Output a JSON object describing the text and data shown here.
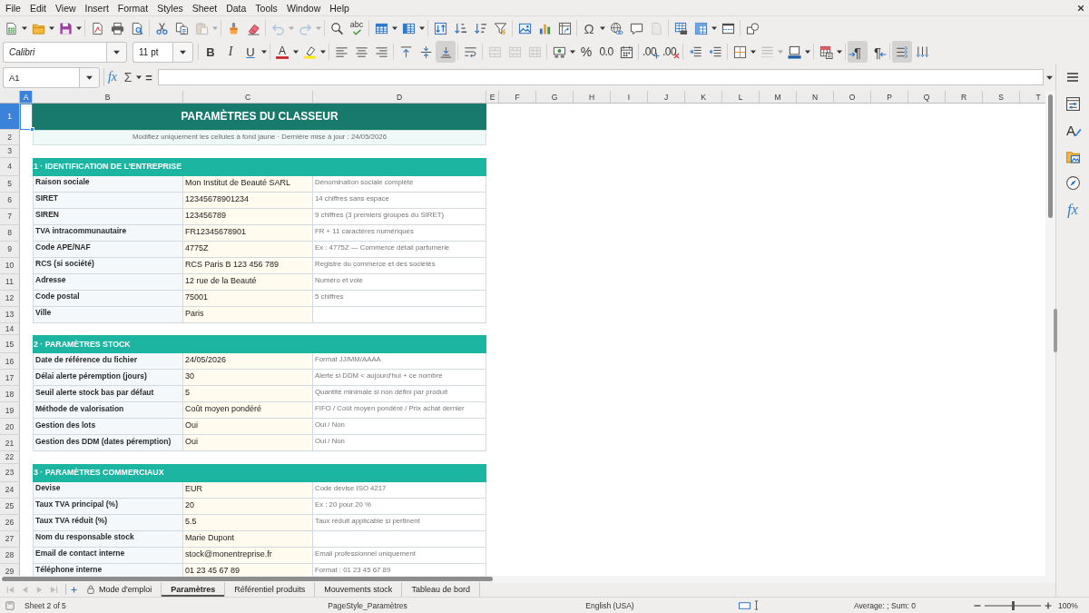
{
  "menu_bar": [
    "File",
    "Edit",
    "View",
    "Insert",
    "Format",
    "Styles",
    "Sheet",
    "Data",
    "Tools",
    "Window",
    "Help"
  ],
  "standard_toolbar": [
    [
      {
        "kind": "new",
        "dropdown": true,
        "disabled": false
      },
      {
        "kind": "open",
        "dropdown": true,
        "disabled": false
      },
      {
        "kind": "save",
        "dropdown": true,
        "disabled": false
      }
    ],
    [
      {
        "kind": "exportpdf",
        "disabled": false
      },
      {
        "kind": "print",
        "disabled": false
      },
      {
        "kind": "printpreview",
        "disabled": false
      }
    ],
    [
      {
        "kind": "cut",
        "disabled": false
      },
      {
        "kind": "copy",
        "disabled": false
      },
      {
        "kind": "paste",
        "dropdown": true,
        "disabled": true
      }
    ],
    [
      {
        "kind": "cloneformat",
        "disabled": false
      },
      {
        "kind": "clearformat",
        "disabled": false
      }
    ],
    [
      {
        "kind": "undo",
        "dropdown": true,
        "disabled": true
      },
      {
        "kind": "redo",
        "dropdown": true,
        "disabled": true
      }
    ],
    [
      {
        "kind": "findreplace",
        "disabled": false
      },
      {
        "kind": "spelling",
        "glyph": "abc",
        "disabled": false
      }
    ],
    [
      {
        "kind": "rows",
        "dropdown": true,
        "disabled": false
      },
      {
        "kind": "columns",
        "dropdown": true,
        "disabled": false
      }
    ],
    [
      {
        "kind": "sort",
        "disabled": false
      },
      {
        "kind": "sortasc",
        "disabled": false
      },
      {
        "kind": "sortdesc",
        "disabled": false
      },
      {
        "kind": "autofilter",
        "disabled": false
      }
    ],
    [
      {
        "kind": "image",
        "disabled": false
      },
      {
        "kind": "chart",
        "disabled": false
      },
      {
        "kind": "pivot",
        "disabled": false
      }
    ],
    [
      {
        "kind": "specialchar",
        "glyph": "Ω",
        "dropdown": true,
        "disabled": false
      },
      {
        "kind": "hyperlink",
        "disabled": false
      },
      {
        "kind": "comment",
        "disabled": false
      },
      {
        "kind": "headerfooter",
        "disabled": true
      }
    ],
    [
      {
        "kind": "printarea",
        "disabled": false
      },
      {
        "kind": "freeze",
        "dropdown": true,
        "disabled": false
      },
      {
        "kind": "split",
        "disabled": false
      }
    ],
    [
      {
        "kind": "drawfunctions",
        "disabled": false
      }
    ]
  ],
  "format_toolbar": {
    "font_name": "Calibri",
    "font_size": "11 pt",
    "groups": [
      [
        {
          "kind": "bold",
          "glyph": "B",
          "on": false,
          "disabled": false
        },
        {
          "kind": "italic",
          "glyph": "I",
          "on": false,
          "disabled": false
        },
        {
          "kind": "underline",
          "glyph": "U",
          "dropdown": true,
          "on": false,
          "disabled": false
        }
      ],
      [
        {
          "kind": "fontcolor",
          "glyph": "A",
          "dropdown": true,
          "on": false,
          "disabled": false
        },
        {
          "kind": "highlight",
          "dropdown": true,
          "on": false,
          "disabled": false
        }
      ],
      [
        {
          "kind": "alignleft",
          "on": false,
          "disabled": false
        },
        {
          "kind": "aligncenter",
          "on": false,
          "disabled": false
        },
        {
          "kind": "alignright",
          "on": false,
          "disabled": false
        }
      ],
      [
        {
          "kind": "aligntop",
          "on": false,
          "disabled": false
        },
        {
          "kind": "alignmiddle",
          "on": false,
          "disabled": false
        },
        {
          "kind": "alignbottom",
          "on": true,
          "disabled": false
        }
      ],
      [
        {
          "kind": "wrap",
          "on": false,
          "disabled": false
        }
      ],
      [
        {
          "kind": "mergecenter",
          "on": false,
          "disabled": true
        },
        {
          "kind": "merge",
          "on": false,
          "disabled": true
        },
        {
          "kind": "unmerge",
          "on": false,
          "disabled": true
        }
      ],
      [
        {
          "kind": "currency",
          "dropdown": true,
          "on": false,
          "disabled": false
        },
        {
          "kind": "percent",
          "glyph": "%",
          "on": false,
          "disabled": false
        },
        {
          "kind": "number",
          "glyph": "0.0",
          "on": false,
          "disabled": false
        },
        {
          "kind": "date",
          "on": false,
          "disabled": false
        }
      ],
      [
        {
          "kind": "adddecimal",
          "glyph": ".00",
          "on": false,
          "disabled": false
        },
        {
          "kind": "deletedecimal",
          "glyph": ".00",
          "on": false,
          "disabled": false
        }
      ],
      [
        {
          "kind": "indent",
          "on": false,
          "disabled": false
        },
        {
          "kind": "outdent",
          "on": false,
          "disabled": false
        }
      ],
      [
        {
          "kind": "borders",
          "dropdown": true,
          "on": false,
          "disabled": false
        },
        {
          "kind": "borderstyle",
          "dropdown": true,
          "on": false,
          "disabled": true
        },
        {
          "kind": "bordercolor",
          "dropdown": true,
          "on": false,
          "disabled": false
        }
      ],
      [
        {
          "kind": "conditional",
          "dropdown": true,
          "on": false,
          "disabled": false
        }
      ],
      [
        {
          "kind": "ltr",
          "glyph": "¶",
          "on": true,
          "disabled": false
        },
        {
          "kind": "rtl",
          "glyph": "¶",
          "on": false,
          "disabled": false
        }
      ],
      [
        {
          "kind": "texthorizontal",
          "on": true,
          "disabled": false
        },
        {
          "kind": "textvertical",
          "on": false,
          "disabled": false
        }
      ]
    ]
  },
  "formula_bar": {
    "name_box": "A1",
    "buttons": [
      {
        "kind": "functionwizard",
        "glyph": "fx"
      },
      {
        "kind": "sum",
        "glyph": "Σ",
        "dropdown": true
      },
      {
        "kind": "equals",
        "glyph": "="
      }
    ]
  },
  "sheet": {
    "columns": [
      {
        "label": "A",
        "selected": true
      },
      {
        "label": "B",
        "selected": false
      },
      {
        "label": "C",
        "selected": false
      },
      {
        "label": "D",
        "selected": false
      },
      {
        "label": "E",
        "selected": false
      },
      {
        "label": "F",
        "selected": false
      },
      {
        "label": "G",
        "selected": false
      },
      {
        "label": "H",
        "selected": false
      },
      {
        "label": "I",
        "selected": false
      },
      {
        "label": "J",
        "selected": false
      },
      {
        "label": "K",
        "selected": false
      },
      {
        "label": "L",
        "selected": false
      },
      {
        "label": "M",
        "selected": false
      },
      {
        "label": "N",
        "selected": false
      },
      {
        "label": "O",
        "selected": false
      },
      {
        "label": "P",
        "selected": false
      },
      {
        "label": "Q",
        "selected": false
      },
      {
        "label": "R",
        "selected": false
      },
      {
        "label": "S",
        "selected": false
      },
      {
        "label": "T",
        "selected": false
      }
    ],
    "rows": [
      {
        "number": "1",
        "selected": true,
        "kind": "title",
        "cells": [
          "PARAMÈTRES DU CLASSEUR"
        ]
      },
      {
        "number": "2",
        "selected": false,
        "kind": "note",
        "cells": [
          "Modifiez uniquement les cellules à fond jaune · Dernière mise à jour : 24/05/2026"
        ]
      },
      {
        "number": "3",
        "selected": false,
        "kind": "blank"
      },
      {
        "number": "4",
        "selected": false,
        "kind": "section",
        "cells": [
          "1 · IDENTIFICATION DE L’ENTREPRISE"
        ]
      },
      {
        "number": "5",
        "selected": false,
        "kind": "field",
        "cells": [
          "Raison sociale",
          "Mon Institut de Beauté SARL",
          "Dénomination sociale complète"
        ]
      },
      {
        "number": "6",
        "selected": false,
        "kind": "field",
        "cells": [
          "SIRET",
          "12345678901234",
          "14 chiffres sans espace"
        ]
      },
      {
        "number": "7",
        "selected": false,
        "kind": "field",
        "cells": [
          "SIREN",
          "123456789",
          "9 chiffres (3 premiers groupes du SIRET)"
        ]
      },
      {
        "number": "8",
        "selected": false,
        "kind": "field",
        "cells": [
          "TVA intracommunautaire",
          "FR12345678901",
          "FR + 11 caractères numériques"
        ]
      },
      {
        "number": "9",
        "selected": false,
        "kind": "field",
        "cells": [
          "Code APE/NAF",
          "4775Z",
          "Ex : 4775Z — Commerce détail parfumerie"
        ]
      },
      {
        "number": "10",
        "selected": false,
        "kind": "field",
        "cells": [
          "RCS (si société)",
          "RCS Paris B 123 456 789",
          "Registre du commerce et des sociétés"
        ]
      },
      {
        "number": "11",
        "selected": false,
        "kind": "field",
        "cells": [
          "Adresse",
          "12 rue de la Beauté",
          "Numéro et voie"
        ]
      },
      {
        "number": "12",
        "selected": false,
        "kind": "field",
        "cells": [
          "Code postal",
          "75001",
          "5 chiffres"
        ]
      },
      {
        "number": "13",
        "selected": false,
        "kind": "field",
        "cells": [
          "Ville",
          "Paris"
        ]
      },
      {
        "number": "14",
        "selected": false,
        "kind": "blank"
      },
      {
        "number": "15",
        "selected": false,
        "kind": "section",
        "cells": [
          "2 · PARAMÈTRES STOCK"
        ]
      },
      {
        "number": "16",
        "selected": false,
        "kind": "field",
        "cells": [
          "Date de référence du fichier",
          "24/05/2026",
          "Format JJ/MM/AAAA"
        ]
      },
      {
        "number": "17",
        "selected": false,
        "kind": "field",
        "cells": [
          "Délai alerte péremption (jours)",
          "30",
          "Alerte si DDM < aujourd'hui + ce nombre"
        ]
      },
      {
        "number": "18",
        "selected": false,
        "kind": "field",
        "cells": [
          "Seuil alerte stock bas par défaut",
          "5",
          "Quantité minimale si non défini par produit"
        ]
      },
      {
        "number": "19",
        "selected": false,
        "kind": "field",
        "cells": [
          "Méthode de valorisation",
          "Coût moyen pondéré",
          "FIFO / Coût moyen pondéré / Prix achat dernier"
        ]
      },
      {
        "number": "20",
        "selected": false,
        "kind": "field",
        "cells": [
          "Gestion des lots",
          "Oui",
          "Oui / Non"
        ]
      },
      {
        "number": "21",
        "selected": false,
        "kind": "field",
        "cells": [
          "Gestion des DDM (dates péremption)",
          "Oui",
          "Oui / Non"
        ]
      },
      {
        "number": "22",
        "selected": false,
        "kind": "blank"
      },
      {
        "number": "23",
        "selected": false,
        "kind": "section",
        "cells": [
          "3 · PARAMÈTRES COMMERCIAUX"
        ]
      },
      {
        "number": "24",
        "selected": false,
        "kind": "field",
        "cells": [
          "Devise",
          "EUR",
          "Code devise ISO 4217"
        ]
      },
      {
        "number": "25",
        "selected": false,
        "kind": "field",
        "cells": [
          "Taux TVA principal (%)",
          "20",
          "Ex : 20 pour 20 %"
        ]
      },
      {
        "number": "26",
        "selected": false,
        "kind": "field",
        "cells": [
          "Taux TVA réduit (%)",
          "5.5",
          "Taux réduit applicable si pertinent"
        ]
      },
      {
        "number": "27",
        "selected": false,
        "kind": "field",
        "cells": [
          "Nom du responsable stock",
          "Marie Dupont"
        ]
      },
      {
        "number": "28",
        "selected": false,
        "kind": "field",
        "cells": [
          "Email de contact interne",
          "stock@monentreprise.fr",
          "Email professionnel uniquement"
        ]
      },
      {
        "number": "29",
        "selected": false,
        "kind": "field",
        "cells": [
          "Téléphone interne",
          "01 23 45 67 89",
          "Format : 01 23 45 67 89"
        ]
      }
    ]
  },
  "sheet_navigation": [
    {
      "kind": "first",
      "disabled": true
    },
    {
      "kind": "previous",
      "disabled": true
    },
    {
      "kind": "next",
      "disabled": true
    },
    {
      "kind": "last",
      "disabled": true
    }
  ],
  "sheet_tabs": [
    {
      "label": "Mode d'emploi",
      "selected": false,
      "locked": true
    },
    {
      "label": "Paramètres",
      "selected": true,
      "locked": false
    },
    {
      "label": "Référentiel produits",
      "selected": false,
      "locked": false
    },
    {
      "label": "Mouvements stock",
      "selected": false,
      "locked": false
    },
    {
      "label": "Tableau de bord",
      "selected": false,
      "locked": false
    }
  ],
  "sidebar": [
    {
      "kind": "properties"
    },
    {
      "kind": "styles",
      "glyph": "A"
    },
    {
      "kind": "gallery"
    },
    {
      "kind": "navigator"
    },
    {
      "kind": "functions",
      "glyph": "fx"
    }
  ],
  "status_bar": {
    "sheet": "Sheet 2 of 5",
    "page_style": "PageStyle_Paramètres",
    "language": "English (USA)",
    "summary": "Average: ; Sum: 0",
    "zoom_slider": {
      "level": 0.5
    },
    "zoom": "100%"
  }
}
